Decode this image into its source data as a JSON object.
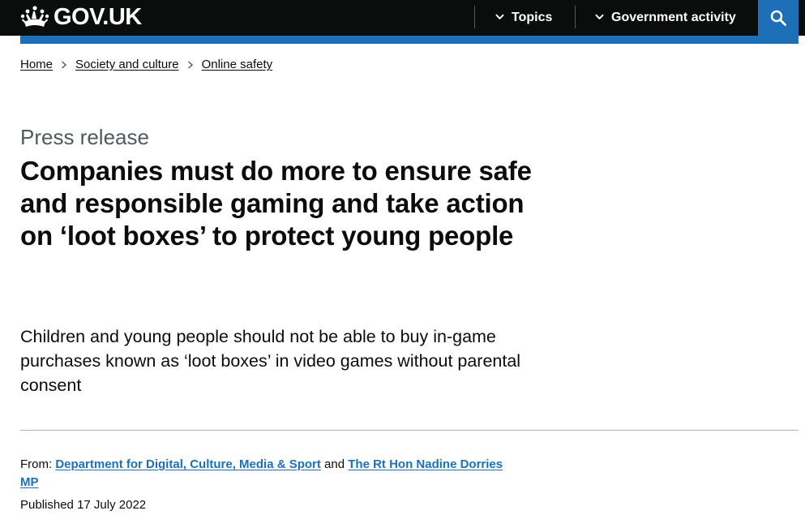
{
  "header": {
    "logo_text": "GOV.UK",
    "nav": [
      {
        "label": "Topics"
      },
      {
        "label": "Government activity"
      }
    ],
    "search_icon": "search-icon"
  },
  "breadcrumbs": [
    {
      "label": "Home"
    },
    {
      "label": "Society and culture"
    },
    {
      "label": "Online safety"
    }
  ],
  "article": {
    "caption": "Press release",
    "title": "Companies must do more to ensure safe and responsible gaming and take action on ‘loot boxes’ to protect young people",
    "lede": "Children and young people should not be able to buy in-game purchases known as ‘loot boxes’ in video games without parental consent"
  },
  "meta": {
    "from_label": "From:",
    "organisations": [
      "Department for Digital, Culture, Media & Sport",
      "The Rt Hon Nadine Dorries MP"
    ],
    "and_text": "and",
    "published_label": "Published",
    "published_date": "17 July 2022"
  },
  "colors": {
    "header_bg": "#0b0c0c",
    "brand_blue": "#1d70b8",
    "caption_grey": "#505a5f"
  }
}
